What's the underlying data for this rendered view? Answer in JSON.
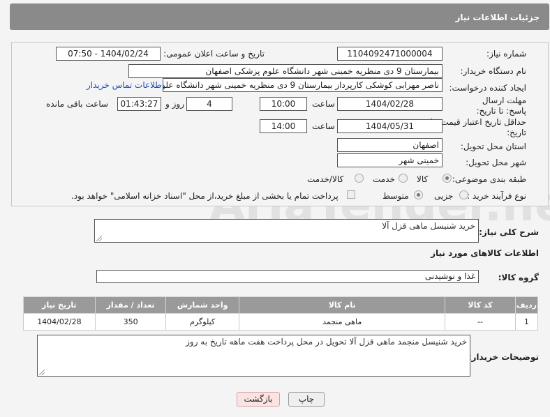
{
  "header": {
    "title": "جزئیات اطلاعات نیاز"
  },
  "form": {
    "need_number_label": "شماره نیاز:",
    "need_number": "1104092471000004",
    "announce_label": "تاریخ و ساعت اعلان عمومی:",
    "announce_value": "1404/02/24 - 07:50",
    "buyer_org_label": "نام دستگاه خریدار:",
    "buyer_org": "بیمارستان 9 دی منظریه خمینی شهر دانشگاه علوم پزشکی اصفهان",
    "creator_label": "ایجاد کننده درخواست:",
    "creator": "ناصر مهرابی کوشکی کارپرداز بیمارستان 9 دی منظریه خمینی شهر دانشگاه علوم پزشکی اصفهان",
    "contact_link": "اطلاعات تماس خریدار",
    "reply_deadline_label": "مهلت ارسال پاسخ: تا تاریخ:",
    "reply_date": "1404/02/28",
    "time_label": "ساعت",
    "reply_time": "10:00",
    "days_value": "4",
    "days_label": "روز و",
    "remaining_time": "01:43:27",
    "remaining_label": "ساعت باقی مانده",
    "price_validity_label": "حداقل تاریخ اعتبار قیمت: تا تاریخ:",
    "price_date": "1404/05/31",
    "time_label2": "ساعت",
    "price_time": "14:00",
    "province_label": "استان محل تحویل:",
    "province": "اصفهان",
    "city_label": "شهر محل تحویل:",
    "city": "خمینی شهر",
    "category_label": "طبقه بندی موضوعی:",
    "category_options": [
      "کالا",
      "خدمت",
      "کالا/خدمت"
    ],
    "process_label": "نوع فرآیند خرید :",
    "process_options": [
      "جزیی",
      "متوسط"
    ],
    "payment_note": "پرداخت تمام یا بخشی از مبلغ خرید،از محل \"اسناد خزانه اسلامی\" خواهد بود."
  },
  "description": {
    "label": "شرح کلی نیاز:",
    "value": "خرید شنیسل ماهی قزل آلا"
  },
  "goods": {
    "section_title": "اطلاعات کالاهای مورد نیاز",
    "group_label": "گروه کالا:",
    "group_value": "غذا و نوشیدنی",
    "columns": [
      "ردیف",
      "کد کالا",
      "نام کالا",
      "واحد شمارش",
      "تعداد / مقدار",
      "تاریخ نیاز"
    ],
    "rows": [
      [
        "1",
        "--",
        "ماهی منجمد",
        "کیلوگرم",
        "350",
        "1404/02/28"
      ]
    ]
  },
  "buyer_notes": {
    "label": "توضیحات خریدار:",
    "value": "خرید شنیسل منجمد ماهی قزل آلا تحویل در محل پرداخت هفت ماهه تاریخ به روز"
  },
  "buttons": {
    "print": "چاپ",
    "back": "بازگشت"
  },
  "watermark": "AriaTender.neT"
}
